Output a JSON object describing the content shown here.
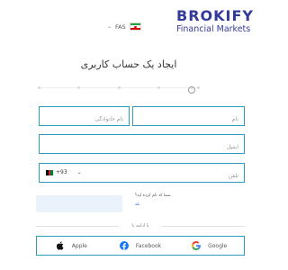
{
  "header": {
    "language": "FAS",
    "brand_name": "BROKIFY",
    "brand_sub": "Financial Markets"
  },
  "page_title": "ایجاد یک حساب کاربری",
  "form": {
    "first_name_placeholder": "نام",
    "last_name_placeholder": "نام خانوادگی",
    "email_placeholder": "ایمیل",
    "phone_placeholder": "تلفن",
    "phone_code": "+93"
  },
  "code": {
    "question": "شما کد نام کرده اید؟",
    "link": "بله"
  },
  "divider_text": "یا ادامه با",
  "social": {
    "apple": "Apple",
    "facebook": "Facebook",
    "google": "Google"
  },
  "colors": {
    "brand": "#333a99",
    "field_border": "#2f9bb8"
  },
  "icons": [
    "chevron-down-icon",
    "iran-flag-icon",
    "info-icon",
    "afghanistan-flag-icon",
    "apple-icon",
    "facebook-icon",
    "google-icon"
  ]
}
